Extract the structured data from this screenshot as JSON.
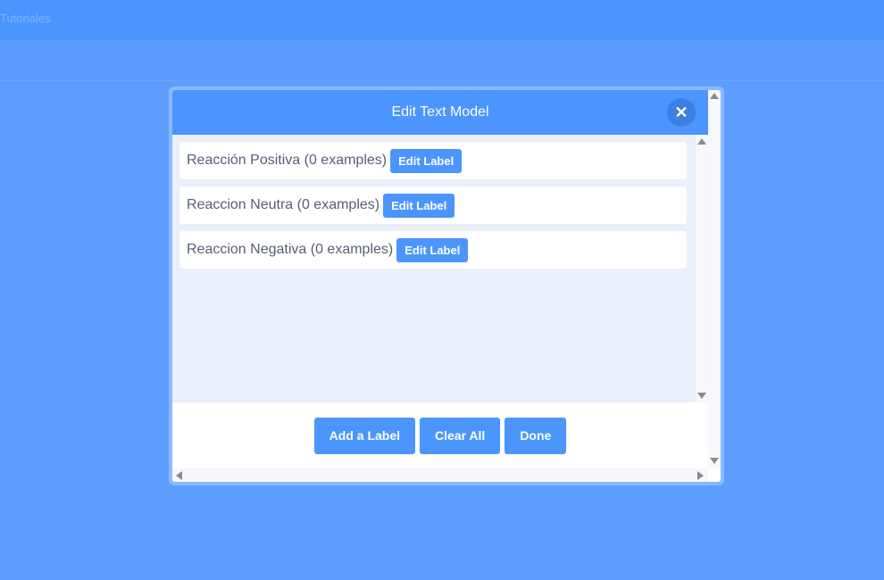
{
  "topbar": {
    "text": "Tutoriales"
  },
  "modal": {
    "title": "Edit Text Model",
    "close_icon": "close-icon",
    "labels": [
      {
        "text": "Reacción Positiva (0 examples)",
        "button": "Edit Label"
      },
      {
        "text": "Reaccion Neutra (0 examples)",
        "button": "Edit Label"
      },
      {
        "text": "Reaccion Negativa (0 examples)",
        "button": "Edit Label"
      }
    ],
    "footer": {
      "add_label": "Add a Label",
      "clear_all": "Clear All",
      "done": "Done"
    }
  },
  "colors": {
    "background": "#5c9dff",
    "header": "#4b95ff",
    "list_bg": "#e9f0fb",
    "label_text": "#575e75"
  }
}
